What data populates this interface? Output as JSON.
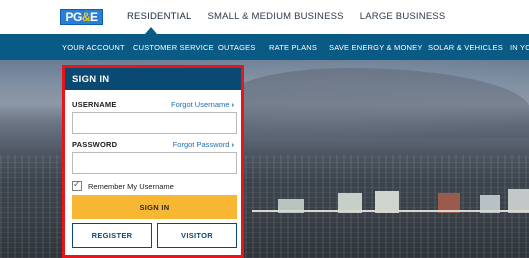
{
  "logo": {
    "part1": "PG",
    "amp": "&",
    "part2": "E"
  },
  "top_tabs": [
    {
      "label": "RESIDENTIAL",
      "active": true
    },
    {
      "label": "SMALL & MEDIUM BUSINESS",
      "active": false
    },
    {
      "label": "LARGE BUSINESS",
      "active": false
    }
  ],
  "nav": {
    "items": [
      {
        "label": "YOUR ACCOUNT"
      },
      {
        "label": "CUSTOMER SERVICE"
      },
      {
        "label": "OUTAGES"
      },
      {
        "label": "RATE PLANS"
      },
      {
        "label": "SAVE ENERGY & MONEY"
      },
      {
        "label": "SOLAR & VEHICLES"
      },
      {
        "label": "IN YO"
      }
    ]
  },
  "signin": {
    "title": "SIGN IN",
    "username_label": "USERNAME",
    "forgot_username": "Forgot Username",
    "password_label": "PASSWORD",
    "forgot_password": "Forgot Password",
    "username_value": "",
    "password_value": "",
    "remember_label": "Remember My Username",
    "remember_checked": true,
    "signin_button": "SIGN IN",
    "register_button": "REGISTER",
    "visitor_button": "VISITOR"
  },
  "colors": {
    "nav_blue": "#0a5a86",
    "signin_header": "#0a4a72",
    "signin_button": "#f7b733",
    "highlight_border": "#e8141a",
    "link": "#1f6fb0"
  }
}
